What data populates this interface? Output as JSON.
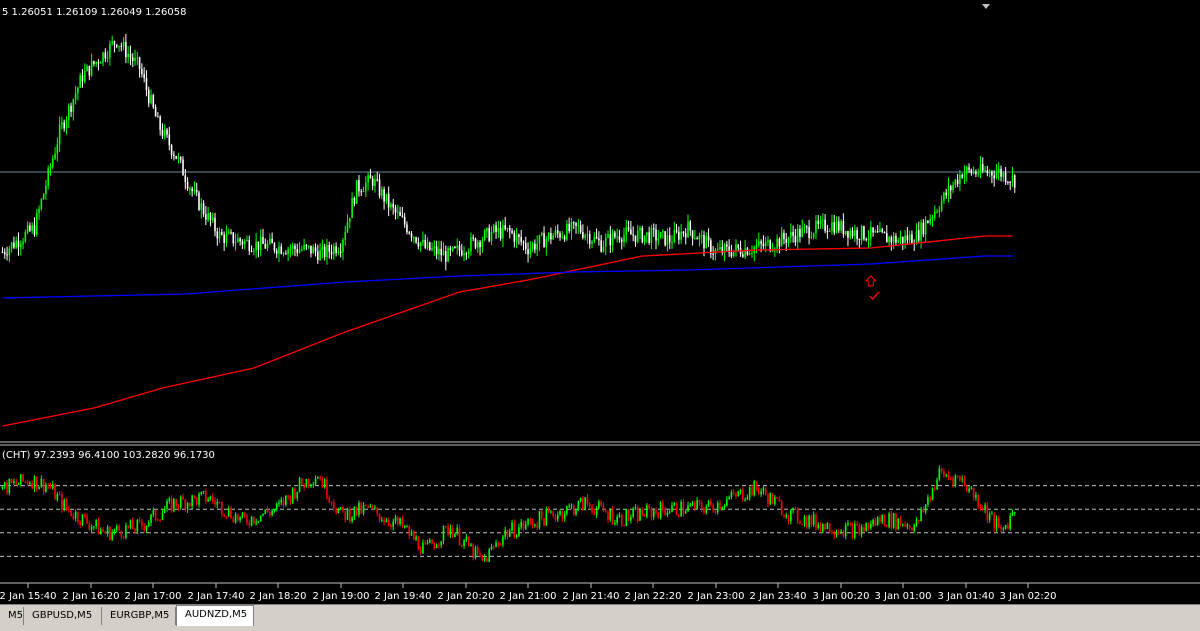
{
  "header": {
    "ohlc_text": "5  1.26051 1.26109 1.26049 1.26058",
    "indicator_text": "(CHT) 97.2393 96.4100 103.2820 96.1730"
  },
  "tabs": [
    {
      "label": "M5",
      "active": false
    },
    {
      "label": "GBPUSD,M5",
      "active": false
    },
    {
      "label": "EURGBP,M5",
      "active": false
    },
    {
      "label": "AUDNZD,M5",
      "active": true
    }
  ],
  "colors": {
    "background": "#000000",
    "bull_candle": "#00ff00",
    "bear_candle": "#ffffff",
    "ma_red": "#ff0000",
    "ma_blue": "#0000ff",
    "hline": "#6c8ca0",
    "histo_up": "#00ff00",
    "histo_down": "#ff0000",
    "level_line": "#c0c0c0",
    "arrow": "#ff0000",
    "separator": "#c0c0c0"
  },
  "chart_data": [
    {
      "type": "candlestick",
      "title": "",
      "x_ticks": [
        "2 Jan 15:40",
        "2 Jan 16:20",
        "2 Jan 17:00",
        "2 Jan 17:40",
        "2 Jan 18:20",
        "2 Jan 19:00",
        "2 Jan 19:40",
        "2 Jan 20:20",
        "2 Jan 21:00",
        "2 Jan 21:40",
        "2 Jan 22:20",
        "2 Jan 23:00",
        "2 Jan 23:40",
        "3 Jan 00:20",
        "3 Jan 01:00",
        "3 Jan 01:40",
        "3 Jan 02:20"
      ],
      "ylim": [
        0,
        100
      ],
      "trend_points": [
        [
          0,
          42
        ],
        [
          14,
          48
        ],
        [
          25,
          72
        ],
        [
          35,
          86
        ],
        [
          50,
          95
        ],
        [
          60,
          88
        ],
        [
          68,
          74
        ],
        [
          76,
          66
        ],
        [
          84,
          56
        ],
        [
          95,
          46
        ],
        [
          110,
          44
        ],
        [
          125,
          43
        ],
        [
          135,
          42.5
        ],
        [
          140,
          41.5
        ],
        [
          148,
          44
        ],
        [
          155,
          58
        ],
        [
          162,
          60
        ],
        [
          170,
          53
        ],
        [
          185,
          43
        ],
        [
          195,
          41
        ],
        [
          205,
          44
        ],
        [
          215,
          47
        ],
        [
          222,
          47
        ],
        [
          230,
          43
        ],
        [
          240,
          46
        ],
        [
          252,
          48
        ],
        [
          262,
          44
        ],
        [
          270,
          46.5
        ],
        [
          285,
          46
        ],
        [
          292,
          45
        ],
        [
          300,
          48
        ],
        [
          312,
          42
        ],
        [
          328,
          43
        ],
        [
          336,
          44
        ],
        [
          350,
          47
        ],
        [
          357,
          48
        ],
        [
          363,
          49
        ],
        [
          372,
          47
        ],
        [
          392,
          45
        ],
        [
          400,
          46
        ],
        [
          410,
          54
        ],
        [
          420,
          62
        ],
        [
          436,
          62
        ],
        [
          443,
          60
        ]
      ],
      "moving_averages": [
        {
          "color": "red",
          "points": [
            [
              0,
              -1.5
            ],
            [
              40,
              3
            ],
            [
              70,
              8
            ],
            [
              110,
              13
            ],
            [
              150,
              22
            ],
            [
              200,
              32
            ],
            [
              230,
              35
            ],
            [
              280,
              41
            ],
            [
              330,
              42.5
            ],
            [
              380,
              43
            ],
            [
              430,
              46
            ]
          ]
        },
        {
          "color": "blue",
          "points": [
            [
              0,
              30.5
            ],
            [
              80,
              31.5
            ],
            [
              150,
              34.5
            ],
            [
              200,
              36
            ],
            [
              250,
              37
            ],
            [
              300,
              37.5
            ],
            [
              380,
              39
            ],
            [
              430,
              41
            ]
          ]
        }
      ],
      "horizontal_line": 62,
      "arrow_marker": {
        "index": 380,
        "value": 36
      }
    },
    {
      "type": "histogram",
      "title": "",
      "levels": [
        80,
        60,
        40,
        20
      ],
      "ylim": [
        0,
        100
      ],
      "trend_points": [
        [
          0,
          78
        ],
        [
          12,
          85
        ],
        [
          20,
          80
        ],
        [
          28,
          60
        ],
        [
          45,
          40
        ],
        [
          60,
          45
        ],
        [
          75,
          65
        ],
        [
          90,
          70
        ],
        [
          105,
          50
        ],
        [
          120,
          60
        ],
        [
          130,
          80
        ],
        [
          138,
          90
        ],
        [
          148,
          55
        ],
        [
          160,
          60
        ],
        [
          175,
          45
        ],
        [
          185,
          25
        ],
        [
          196,
          45
        ],
        [
          210,
          15
        ],
        [
          220,
          40
        ],
        [
          240,
          55
        ],
        [
          255,
          65
        ],
        [
          270,
          52
        ],
        [
          290,
          60
        ],
        [
          310,
          62
        ],
        [
          330,
          78
        ],
        [
          345,
          55
        ],
        [
          362,
          45
        ],
        [
          375,
          42
        ],
        [
          385,
          52
        ],
        [
          400,
          46
        ],
        [
          410,
          90
        ],
        [
          420,
          85
        ],
        [
          430,
          60
        ],
        [
          437,
          40
        ],
        [
          443,
          60
        ]
      ]
    }
  ]
}
